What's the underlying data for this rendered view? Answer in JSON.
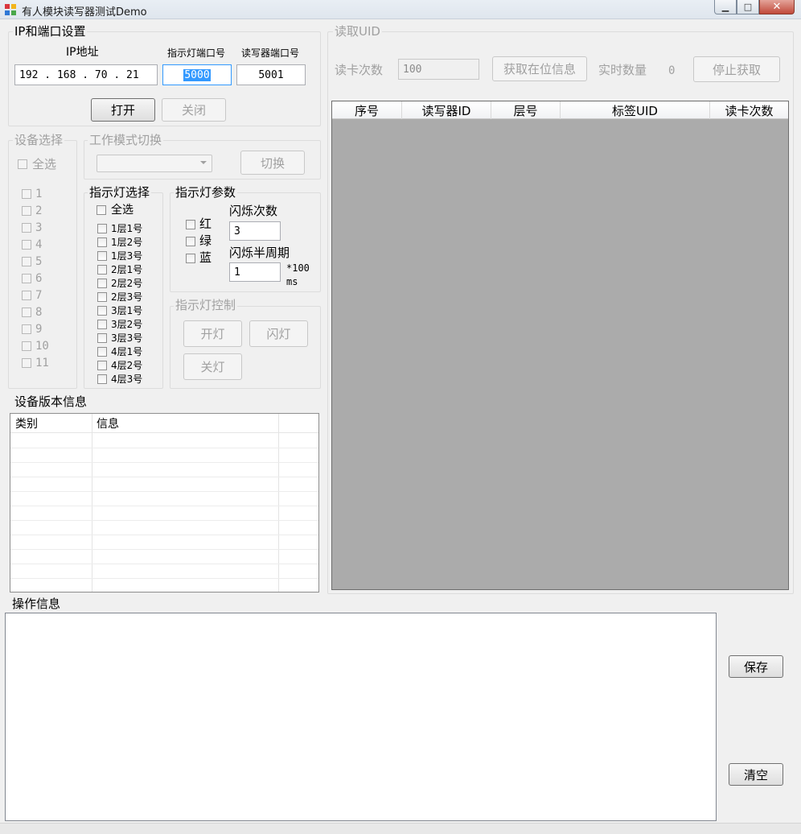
{
  "window": {
    "title": "有人模块读写器测试Demo",
    "min_glyph": "▁",
    "max_glyph": "□",
    "close_glyph": "✕"
  },
  "ip_port": {
    "legend": "IP和端口设置",
    "ip_label": "IP地址",
    "ip_value": "192 . 168 .  70  .  21",
    "light_port_label": "指示灯端口号",
    "light_port_value": "5000",
    "reader_port_label": "读写器端口号",
    "reader_port_value": "5001",
    "open_label": "打开",
    "close_label": "关闭"
  },
  "device_select": {
    "legend": "设备选择",
    "all_label": "全选",
    "items": [
      "1",
      "2",
      "3",
      "4",
      "5",
      "6",
      "7",
      "8",
      "9",
      "10",
      "11"
    ]
  },
  "mode_switch": {
    "legend": "工作模式切换",
    "selected": "",
    "switch_label": "切换"
  },
  "light_select": {
    "legend": "指示灯选择",
    "all_label": "全选",
    "items": [
      "1层1号",
      "1层2号",
      "1层3号",
      "2层1号",
      "2层2号",
      "2层3号",
      "3层1号",
      "3层2号",
      "3层3号",
      "4层1号",
      "4层2号",
      "4层3号"
    ]
  },
  "light_params": {
    "legend": "指示灯参数",
    "red_label": "红",
    "green_label": "绿",
    "blue_label": "蓝",
    "flash_count_label": "闪烁次数",
    "flash_count_value": "3",
    "half_period_label": "闪烁半周期",
    "half_period_value": "1",
    "unit_line1": "*100",
    "unit_line2": "ms"
  },
  "light_control": {
    "legend": "指示灯控制",
    "on_label": "开灯",
    "flash_label": "闪灯",
    "off_label": "关灯"
  },
  "version": {
    "legend": "设备版本信息",
    "columns": [
      "类别",
      "信息",
      ""
    ]
  },
  "read_uid": {
    "legend": "读取UID",
    "read_count_label": "读卡次数",
    "read_count_value": "100",
    "get_info_label": "获取在位信息",
    "realtime_label": "实时数量",
    "realtime_value": "0",
    "stop_label": "停止获取",
    "columns": [
      "序号",
      "读写器ID",
      "层号",
      "标签UID",
      "读卡次数"
    ]
  },
  "log": {
    "legend": "操作信息",
    "save_label": "保存",
    "clear_label": "清空"
  },
  "colors": {
    "window_bg": "#f0f0f0",
    "grid_bg": "#ababab",
    "selection": "#3399ff",
    "close_button": "#c0493a"
  }
}
